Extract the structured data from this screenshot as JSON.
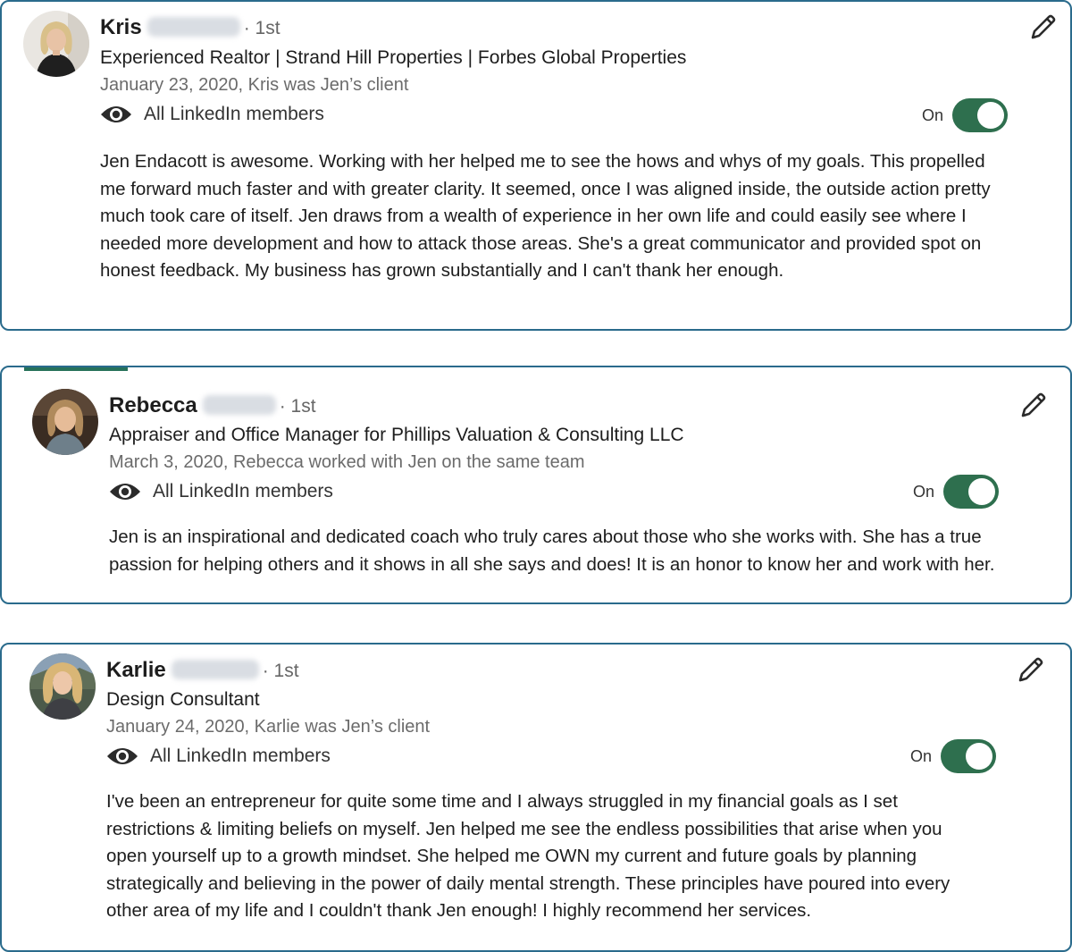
{
  "recommendations": [
    {
      "first_name": "Kris",
      "degree": "· 1st",
      "headline": "Experienced Realtor | Strand Hill Properties | Forbes Global Properties",
      "relation": "January 23, 2020, Kris was Jen’s client",
      "visibility": "All LinkedIn members",
      "toggle_label": "On",
      "toggle_on": true,
      "text": "Jen Endacott is awesome. Working with her helped me to see the hows and whys of my goals. This propelled me forward much faster and with greater clarity. It seemed, once I was aligned inside, the outside action pretty much took care of itself. Jen draws from a wealth of experience in her own life and could easily see where I needed more development and how to attack those areas. She's a great communicator and provided spot on honest feedback. My business has grown substantially and I can't thank her enough."
    },
    {
      "first_name": "Rebecca",
      "degree": "· 1st",
      "headline": "Appraiser and Office Manager for Phillips Valuation & Consulting LLC",
      "relation": "March 3, 2020, Rebecca worked with Jen on the same team",
      "visibility": "All LinkedIn members",
      "toggle_label": "On",
      "toggle_on": true,
      "text": "Jen is an inspirational and dedicated coach who truly cares about those who she works with. She has a true passion for helping others and it shows in all she says and does! It is an honor to know her and work with her."
    },
    {
      "first_name": "Karlie",
      "degree": "· 1st",
      "headline": "Design Consultant",
      "relation": "January 24, 2020, Karlie was Jen’s client",
      "visibility": "All LinkedIn members",
      "toggle_label": "On",
      "toggle_on": true,
      "text": "I've been an entrepreneur for quite some time and I always struggled in my financial goals as I set restrictions & limiting beliefs on myself. Jen helped me see the endless possibilities that arise when you open yourself up to a growth mindset. She helped me OWN my current and future goals by planning strategically and believing in the power of daily mental strength. These principles have poured into every other area of my life and I couldn't thank Jen enough! I highly recommend her services."
    }
  ],
  "colors": {
    "card_border": "#2a6b8c",
    "toggle_on": "#2e6f4e",
    "secondary_text": "#6b6b6b"
  },
  "icons": {
    "edit": "pencil-icon",
    "visibility": "eye-icon"
  }
}
